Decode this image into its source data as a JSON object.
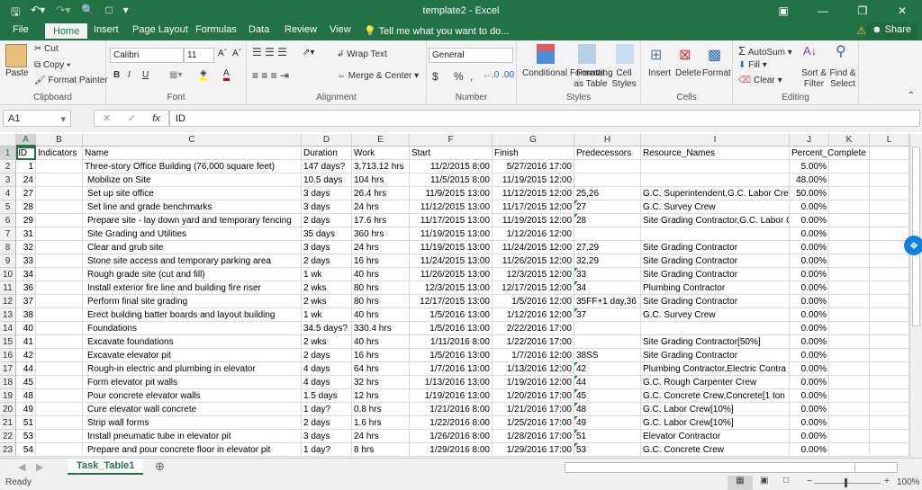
{
  "window": {
    "title": "template2 - Excel",
    "qat_icons": [
      "save-icon",
      "undo-icon",
      "redo-icon",
      "print-preview-icon",
      "new-file-icon",
      "customize-icon"
    ]
  },
  "tabs": [
    "File",
    "Home",
    "Insert",
    "Page Layout",
    "Formulas",
    "Data",
    "Review",
    "View"
  ],
  "active_tab": "Home",
  "tell_me": "Tell me what you want to do...",
  "share_label": "Share",
  "ribbon": {
    "clipboard": {
      "label": "Clipboard",
      "paste": "Paste",
      "cut": "Cut",
      "copy": "Copy",
      "format_painter": "Format Painter"
    },
    "font": {
      "label": "Font",
      "font_name": "Calibri",
      "font_size": "11",
      "bold": "B",
      "italic": "I",
      "underline": "U"
    },
    "alignment": {
      "label": "Alignment",
      "wrap_text": "Wrap Text",
      "merge_center": "Merge & Center"
    },
    "number": {
      "label": "Number",
      "format": "General",
      "currency": "$",
      "percent": "%",
      "comma": ","
    },
    "styles": {
      "label": "Styles",
      "conditional": "Conditional Formatting",
      "format_table": "Format as Table",
      "cell_styles": "Cell Styles"
    },
    "cells": {
      "label": "Cells",
      "insert": "Insert",
      "delete": "Delete",
      "format": "Format"
    },
    "editing": {
      "label": "Editing",
      "autosum": "AutoSum",
      "fill": "Fill",
      "clear": "Clear",
      "sort": "Sort & Filter",
      "find": "Find & Select"
    }
  },
  "formula_bar": {
    "name_box": "A1",
    "formula": "ID",
    "fx": "fx"
  },
  "columns": [
    "A",
    "B",
    "C",
    "D",
    "E",
    "F",
    "G",
    "H",
    "I",
    "J",
    "K",
    "L"
  ],
  "header_row": [
    "ID",
    "Indicators",
    "Name",
    "Duration",
    "Work",
    "Start",
    "Finish",
    "Predecessors",
    "Resource_Names",
    "Percent_Complete"
  ],
  "rows": [
    {
      "n": "2",
      "id": "1",
      "name": "Three-story Office Building (76,000 square feet)",
      "dur": "147 days?",
      "work": "3,713.12 hrs",
      "start": "11/2/2015 8:00",
      "finish": "5/27/2016 17:00",
      "pred": "",
      "res": "",
      "pct": "5.00%",
      "indent": false
    },
    {
      "n": "3",
      "id": "24",
      "name": "Mobilize on Site",
      "dur": "10.5 days",
      "work": "104 hrs",
      "start": "11/5/2015 8:00",
      "finish": "11/19/2015 12:00",
      "pred": "",
      "res": "",
      "pct": "48.00%",
      "indent": true
    },
    {
      "n": "4",
      "id": "27",
      "name": "Set up site office",
      "dur": "3 days",
      "work": "26.4 hrs",
      "start": "11/9/2015 13:00",
      "finish": "11/12/2015 12:00",
      "pred": "25,26",
      "res": "G.C. Superintendent,G.C. Labor Cre",
      "pct": "50.00%",
      "indent": true
    },
    {
      "n": "5",
      "id": "28",
      "name": "Set line and grade benchmarks",
      "dur": "3 days",
      "work": "24 hrs",
      "start": "11/12/2015 13:00",
      "finish": "11/17/2015 12:00",
      "pred": "27",
      "res": "G.C. Survey Crew",
      "pct": "0.00%",
      "indent": true
    },
    {
      "n": "6",
      "id": "29",
      "name": "Prepare site - lay down yard and temporary fencing",
      "dur": "2 days",
      "work": "17.6 hrs",
      "start": "11/17/2015 13:00",
      "finish": "11/19/2015 12:00",
      "pred": "28",
      "res": "Site Grading Contractor,G.C. Labor C",
      "pct": "0.00%",
      "indent": true
    },
    {
      "n": "7",
      "id": "31",
      "name": "Site Grading and Utilities",
      "dur": "35 days",
      "work": "360 hrs",
      "start": "11/19/2015 13:00",
      "finish": "1/12/2016 12:00",
      "pred": "",
      "res": "",
      "pct": "0.00%",
      "indent": true
    },
    {
      "n": "8",
      "id": "32",
      "name": "Clear and grub site",
      "dur": "3 days",
      "work": "24 hrs",
      "start": "11/19/2015 13:00",
      "finish": "11/24/2015 12:00",
      "pred": "27,29",
      "res": "Site Grading Contractor",
      "pct": "0.00%",
      "indent": true
    },
    {
      "n": "9",
      "id": "33",
      "name": "Stone site access and temporary parking area",
      "dur": "2 days",
      "work": "16 hrs",
      "start": "11/24/2015 13:00",
      "finish": "11/26/2015 12:00",
      "pred": "32,29",
      "res": "Site Grading Contractor",
      "pct": "0.00%",
      "indent": true
    },
    {
      "n": "10",
      "id": "34",
      "name": "Rough grade site (cut and fill)",
      "dur": "1 wk",
      "work": "40 hrs",
      "start": "11/26/2015 13:00",
      "finish": "12/3/2015 12:00",
      "pred": "33",
      "res": "Site Grading Contractor",
      "pct": "0.00%",
      "indent": true
    },
    {
      "n": "11",
      "id": "36",
      "name": "Install exterior fire line and building fire riser",
      "dur": "2 wks",
      "work": "80 hrs",
      "start": "12/3/2015 13:00",
      "finish": "12/17/2015 12:00",
      "pred": "34",
      "res": "Plumbing Contractor",
      "pct": "0.00%",
      "indent": true
    },
    {
      "n": "12",
      "id": "37",
      "name": "Perform final site grading",
      "dur": "2 wks",
      "work": "80 hrs",
      "start": "12/17/2015 13:00",
      "finish": "1/5/2016 12:00",
      "pred": "35FF+1 day,36",
      "res": "Site Grading Contractor",
      "pct": "0.00%",
      "indent": true
    },
    {
      "n": "13",
      "id": "38",
      "name": "Erect building batter boards and layout building",
      "dur": "1 wk",
      "work": "40 hrs",
      "start": "1/5/2016 13:00",
      "finish": "1/12/2016 12:00",
      "pred": "37",
      "res": "G.C. Survey Crew",
      "pct": "0.00%",
      "indent": true
    },
    {
      "n": "14",
      "id": "40",
      "name": "Foundations",
      "dur": "34.5 days?",
      "work": "330.4 hrs",
      "start": "1/5/2016 13:00",
      "finish": "2/22/2016 17:00",
      "pred": "",
      "res": "",
      "pct": "0.00%",
      "indent": true
    },
    {
      "n": "15",
      "id": "41",
      "name": "Excavate foundations",
      "dur": "2 wks",
      "work": "40 hrs",
      "start": "1/11/2016 8:00",
      "finish": "1/22/2016 17:00",
      "pred": "",
      "res": "Site Grading Contractor[50%]",
      "pct": "0.00%",
      "indent": true
    },
    {
      "n": "16",
      "id": "42",
      "name": "Excavate elevator pit",
      "dur": "2 days",
      "work": "16 hrs",
      "start": "1/5/2016 13:00",
      "finish": "1/7/2016 12:00",
      "pred": "38SS",
      "res": "Site Grading Contractor",
      "pct": "0.00%",
      "indent": true
    },
    {
      "n": "17",
      "id": "44",
      "name": "Rough-in electric and plumbing in elevator",
      "dur": "4 days",
      "work": "64 hrs",
      "start": "1/7/2016 13:00",
      "finish": "1/13/2016 12:00",
      "pred": "42",
      "res": "Plumbing Contractor,Electric Contra",
      "pct": "0.00%",
      "indent": true
    },
    {
      "n": "18",
      "id": "45",
      "name": "Form elevator pit walls",
      "dur": "4 days",
      "work": "32 hrs",
      "start": "1/13/2016 13:00",
      "finish": "1/19/2016 12:00",
      "pred": "44",
      "res": "G.C. Rough Carpenter Crew",
      "pct": "0.00%",
      "indent": true
    },
    {
      "n": "19",
      "id": "48",
      "name": "Pour concrete elevator walls",
      "dur": "1.5 days",
      "work": "12 hrs",
      "start": "1/19/2016 13:00",
      "finish": "1/20/2016 17:00",
      "pred": "45",
      "res": "G.C. Concrete Crew,Concrete[1 ton",
      "pct": "0.00%",
      "indent": true
    },
    {
      "n": "20",
      "id": "49",
      "name": "Cure elevator wall concrete",
      "dur": "1 day?",
      "work": "0.8 hrs",
      "start": "1/21/2016 8:00",
      "finish": "1/21/2016 17:00",
      "pred": "48",
      "res": "G.C. Labor Crew[10%]",
      "pct": "0.00%",
      "indent": true
    },
    {
      "n": "21",
      "id": "51",
      "name": "Strip wall forms",
      "dur": "2 days",
      "work": "1.6 hrs",
      "start": "1/22/2016 8:00",
      "finish": "1/25/2016 17:00",
      "pred": "49",
      "res": "G.C. Labor Crew[10%]",
      "pct": "0.00%",
      "indent": true
    },
    {
      "n": "22",
      "id": "53",
      "name": "Install pneumatic tube in elevator pit",
      "dur": "3 days",
      "work": "24 hrs",
      "start": "1/26/2016 8:00",
      "finish": "1/28/2016 17:00",
      "pred": "51",
      "res": "Elevator Contractor",
      "pct": "0.00%",
      "indent": true
    },
    {
      "n": "23",
      "id": "54",
      "name": "Prepare and pour concrete floor in elevator pit",
      "dur": "1 day?",
      "work": "8 hrs",
      "start": "1/29/2016 8:00",
      "finish": "1/29/2016 17:00",
      "pred": "53",
      "res": "G.C. Concrete Crew",
      "pct": "0.00%",
      "indent": true
    }
  ],
  "sheet_tab": "Task_Table1",
  "status": {
    "ready": "Ready",
    "zoom": "100%"
  }
}
